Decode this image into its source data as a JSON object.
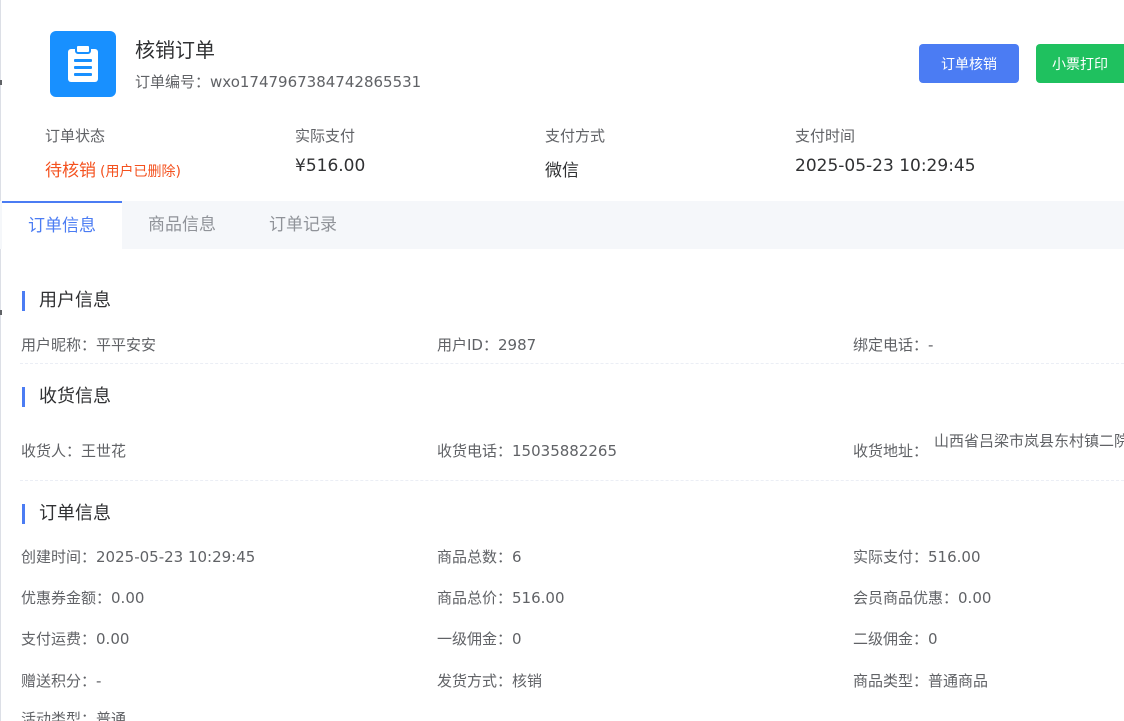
{
  "header": {
    "title": "核销订单",
    "order_no_label": "订单编号：",
    "order_no": "wxo1747967384742865531",
    "icon": "clipboard-icon",
    "accent_color": "#1890ff"
  },
  "actions": {
    "verify_label": "订单核销",
    "print_label": "小票打印"
  },
  "summary": [
    {
      "label": "订单状态",
      "value": "待核销",
      "note": "(用户已删除)"
    },
    {
      "label": "实际支付",
      "value": "¥516.00"
    },
    {
      "label": "支付方式",
      "value": "微信"
    },
    {
      "label": "支付时间",
      "value": "2025-05-23 10:29:45"
    }
  ],
  "tabs": [
    {
      "label": "订单信息",
      "active": true
    },
    {
      "label": "商品信息",
      "active": false
    },
    {
      "label": "订单记录",
      "active": false
    }
  ],
  "user_info": {
    "title": "用户信息",
    "fields": [
      {
        "label": "用户昵称：",
        "value": "平平安安"
      },
      {
        "label": "用户ID：",
        "value": "2987"
      },
      {
        "label": "绑定电话：",
        "value": "-"
      }
    ]
  },
  "shipping_info": {
    "title": "收货信息",
    "fields": [
      {
        "label": "收货人：",
        "value": "王世花"
      },
      {
        "label": "收货电话：",
        "value": "15035882265"
      },
      {
        "label": "收货地址：",
        "value": "山西省吕梁市岚县东村镇二院"
      }
    ]
  },
  "order_info": {
    "title": "订单信息",
    "fields": [
      {
        "label": "创建时间：",
        "value": "2025-05-23 10:29:45"
      },
      {
        "label": "商品总数：",
        "value": "6"
      },
      {
        "label": "实际支付：",
        "value": "516.00"
      },
      {
        "label": "优惠券金额：",
        "value": "0.00"
      },
      {
        "label": "商品总价：",
        "value": "516.00"
      },
      {
        "label": "会员商品优惠：",
        "value": "0.00"
      },
      {
        "label": "支付运费：",
        "value": "0.00"
      },
      {
        "label": "一级佣金：",
        "value": "0"
      },
      {
        "label": "二级佣金：",
        "value": "0"
      },
      {
        "label": "赠送积分：",
        "value": "-"
      },
      {
        "label": "发货方式：",
        "value": "核销"
      },
      {
        "label": "商品类型：",
        "value": "普通商品"
      },
      {
        "label": "活动类型：",
        "value": "普通"
      }
    ]
  }
}
